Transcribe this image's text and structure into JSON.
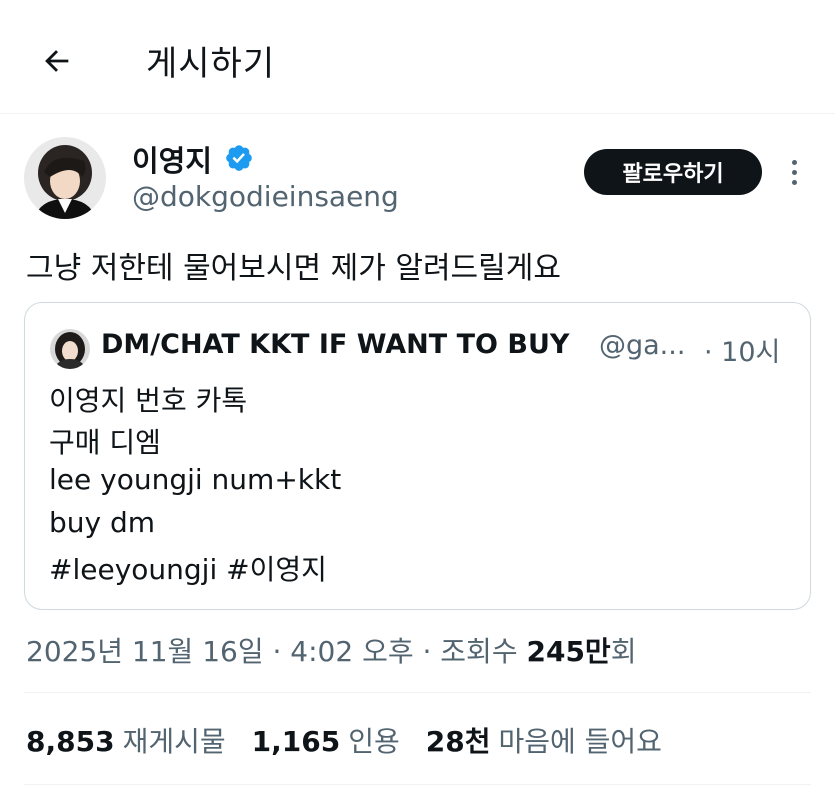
{
  "header": {
    "title": "게시하기",
    "back_icon": "arrow-left-icon"
  },
  "author": {
    "name": "이영지",
    "handle": "@dokgodieinsaeng",
    "verified_icon": "verified-badge-icon",
    "verified_color": "#1d9bf0"
  },
  "actions": {
    "follow_label": "팔로우하기",
    "more_icon": "more-vertical-icon"
  },
  "tweet": {
    "text": "그냥 저한테 물어보시면 제가 알려드릴게요"
  },
  "quote": {
    "name": "DM/CHAT KKT IF WANT TO BUY",
    "handle": "@ga...",
    "time": "· 10시",
    "lines": [
      "이영지 번호 카톡",
      "구매 디엠",
      "lee youngji num+kkt",
      "buy dm",
      "#leeyoungji #이영지"
    ]
  },
  "meta": {
    "date_time": "2025년 11월 16일 · 4:02 오후 · 조회수 ",
    "views": "245만",
    "views_suffix": "회"
  },
  "stats": {
    "reposts_count": "8,853",
    "reposts_label": "재게시물",
    "quotes_count": "1,165",
    "quotes_label": "인용",
    "likes_count": "28천",
    "likes_label": "마음에 들어요"
  },
  "colors": {
    "text_primary": "#0f1419",
    "text_secondary": "#536471",
    "border": "#cfd9de",
    "divider": "#eff3f4",
    "button_bg": "#0f1419"
  }
}
